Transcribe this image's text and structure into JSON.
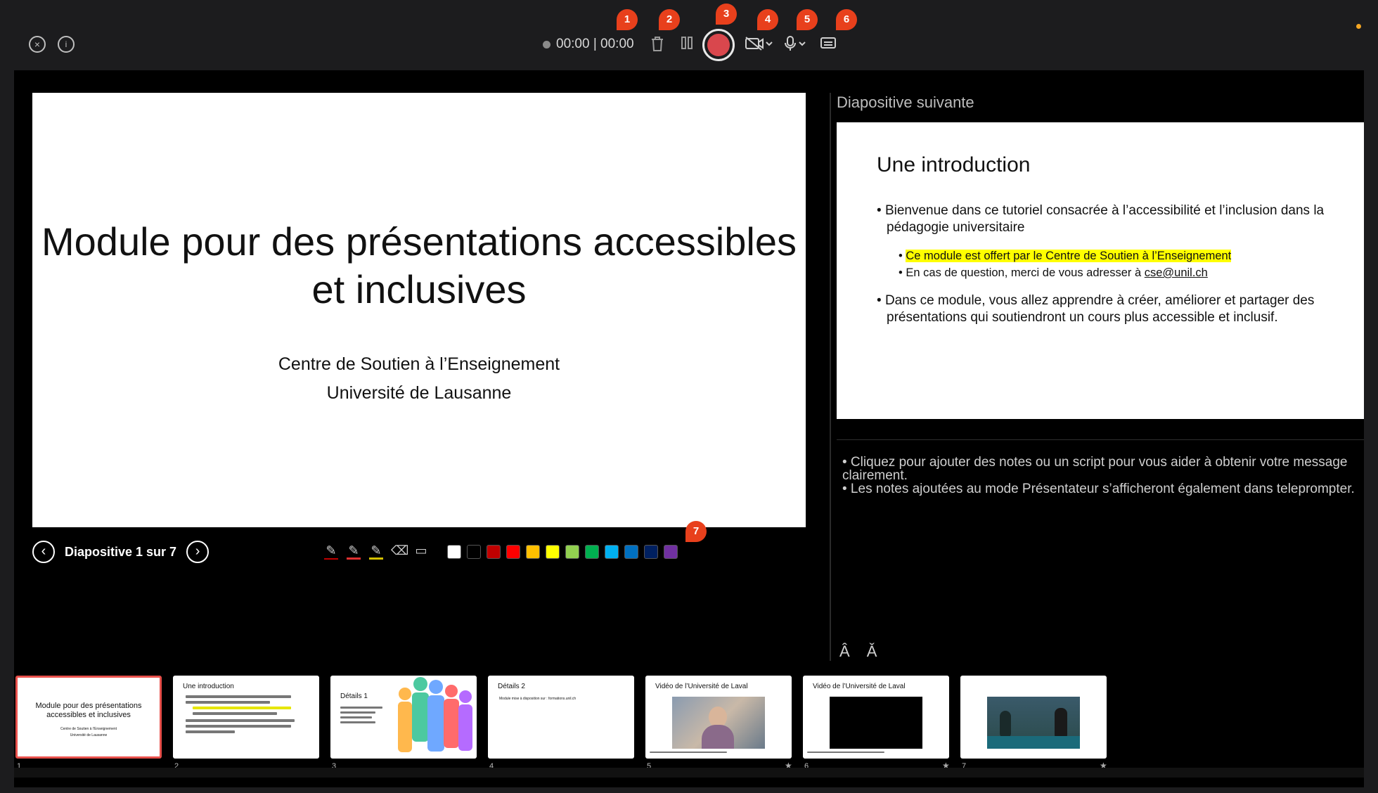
{
  "toolbar": {
    "timer": "00:00 | 00:00",
    "badges": [
      "1",
      "2",
      "3",
      "4",
      "5",
      "6",
      "7"
    ]
  },
  "icons": {
    "close": "close-icon",
    "info": "info-icon",
    "delete": "trash-icon",
    "pause": "pause-icon",
    "record": "record-icon",
    "camera": "camera-off-icon",
    "mic": "microphone-icon",
    "caption": "captions-icon"
  },
  "slide": {
    "title": "Module pour des présentations accessibles et inclusives",
    "subtitle_1": "Centre de Soutien à l’Enseignement",
    "subtitle_2": "Université de Lausanne"
  },
  "navigation": {
    "label": "Diapositive 1 sur 7"
  },
  "pen_colors": [
    "#ffffff",
    "#000000",
    "#c00000",
    "#ff0000",
    "#ffc000",
    "#ffff00",
    "#92d050",
    "#00b050",
    "#00b0f0",
    "#0070c0",
    "#002060",
    "#7030a0"
  ],
  "next_slide": {
    "label": "Diapositive suivante",
    "title": "Une introduction",
    "bullet_1": "Bienvenue dans ce tutoriel consacrée à l’accessibilité et l’inclusion dans la pédagogie universitaire",
    "sub_1": "Ce module est offert par le Centre de Soutien à l’Enseignement",
    "sub_2_prefix": "En cas de question, merci de vous adresser à ",
    "sub_2_email": "cse@unil.ch",
    "bullet_2": "Dans ce module, vous allez apprendre à créer, améliorer et partager des présentations qui soutiendront un cours plus accessible et inclusif."
  },
  "notes": {
    "line_1": "• Cliquez pour ajouter des notes ou un script pour vous aider à obtenir votre message clairement.",
    "line_2": "• Les notes ajoutées au mode Présentateur s’afficheront également dans teleprompter."
  },
  "font_buttons": {
    "increase": "A",
    "decrease": "A"
  },
  "thumbnails": [
    {
      "num": "1",
      "title": "Module pour des présentations accessibles et inclusives",
      "sub": "Centre de Soutien à l’Enseignement",
      "sub2": "Université de Lausanne"
    },
    {
      "num": "2",
      "title": "Une introduction"
    },
    {
      "num": "3",
      "title": "Détails 1"
    },
    {
      "num": "4",
      "title": "Détails 2",
      "sub": "Module mise à disposition sur : formations.unil.ch"
    },
    {
      "num": "5",
      "title": "Vidéo de l’Université de Laval"
    },
    {
      "num": "6",
      "title": "Vidéo de l’Université de Laval"
    },
    {
      "num": "7"
    }
  ]
}
